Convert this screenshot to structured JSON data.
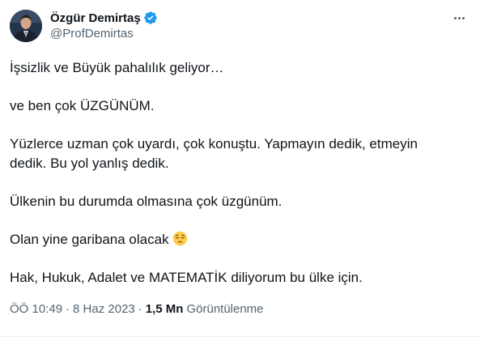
{
  "author": {
    "display_name": "Özgür Demirtaş",
    "handle": "@ProfDemirtas",
    "avatar": "profile-photo",
    "verified_icon": "verified-badge-icon"
  },
  "more_icon": "more-options-icon",
  "tweet": {
    "paragraphs": [
      "İşsizlik ve Büyük pahalılık geliyor…",
      "ve ben çok ÜZGÜNÜM.",
      "Yüzlerce uzman çok uyardı, çok konuştu. Yapmayın dedik, etmeyin dedik. Bu yol yanlış dedik.",
      "Ülkenin bu durumda olmasına çok üzgünüm.",
      "Olan yine garibana olacak",
      "Hak, Hukuk, Adalet ve MATEMATİK diliyorum bu ülke için."
    ],
    "emoji": "pensive-face-emoji"
  },
  "meta": {
    "time": "ÖÖ 10:49",
    "separator": "·",
    "date": "8 Haz 2023",
    "views_count": "1,5 Mn",
    "views_label": "Görüntülenme"
  },
  "colors": {
    "text": "#0f1419",
    "secondary": "#536471",
    "verified_blue": "#1d9bf0"
  }
}
